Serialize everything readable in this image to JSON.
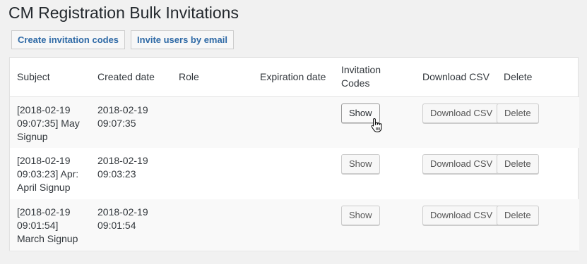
{
  "page": {
    "title": "CM Registration Bulk Invitations"
  },
  "tabs": [
    {
      "label": "Create invitation codes"
    },
    {
      "label": "Invite users by email"
    }
  ],
  "table": {
    "headers": {
      "subject": "Subject",
      "created": "Created date",
      "role": "Role",
      "expiration": "Expiration date",
      "codes": "Invitation Codes",
      "download": "Download CSV",
      "delete": "Delete"
    },
    "rows": [
      {
        "subject": "[2018-02-19 09:07:35] May Signup",
        "created": "2018-02-19 09:07:35",
        "role": "",
        "expiration": "",
        "show_label": "Show",
        "download_label": "Download CSV",
        "delete_label": "Delete"
      },
      {
        "subject": "[2018-02-19 09:03:23] Apr: April Signup",
        "created": "2018-02-19 09:03:23",
        "role": "",
        "expiration": "",
        "show_label": "Show",
        "download_label": "Download CSV",
        "delete_label": "Delete"
      },
      {
        "subject": "[2018-02-19 09:01:54] March Signup",
        "created": "2018-02-19 09:01:54",
        "role": "",
        "expiration": "",
        "show_label": "Show",
        "download_label": "Download CSV",
        "delete_label": "Delete"
      }
    ]
  },
  "cursor": {
    "icon": "hand-pointer-icon"
  }
}
